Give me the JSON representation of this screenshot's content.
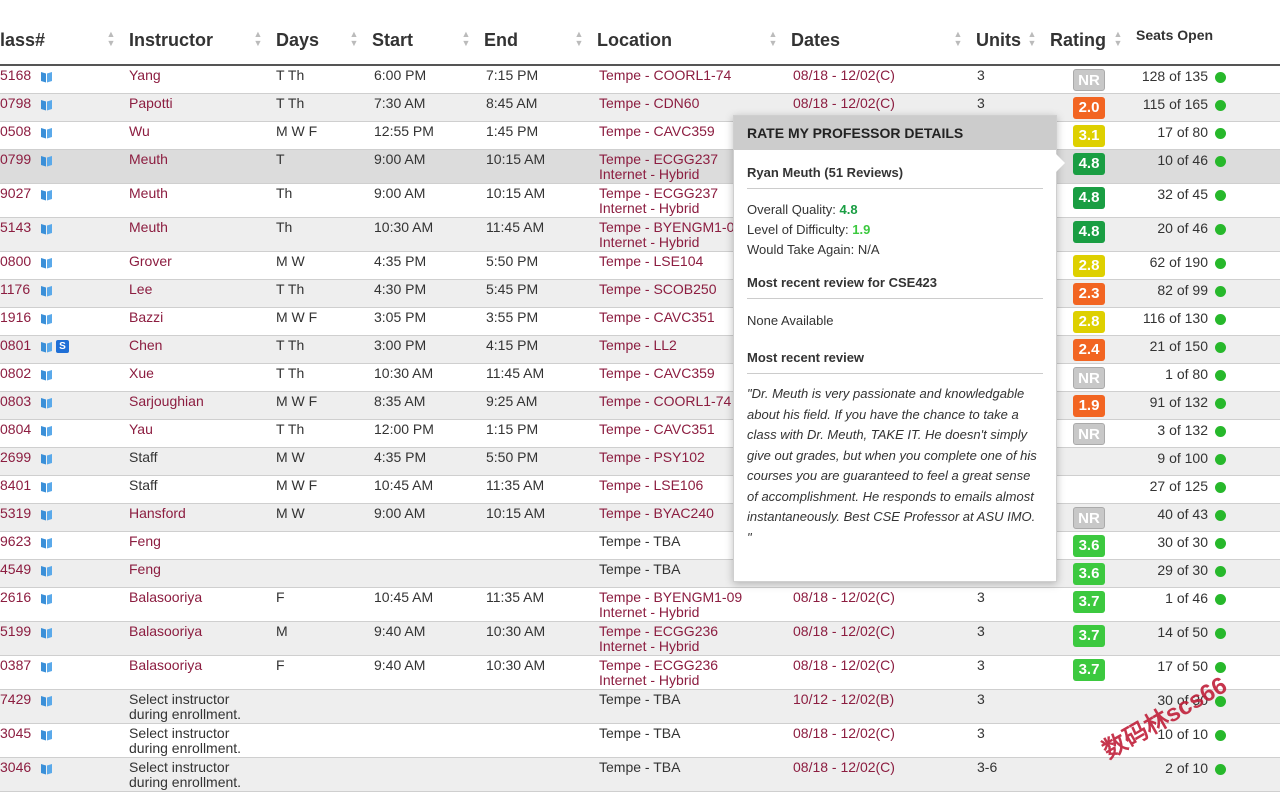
{
  "header": {
    "classnum": "lass#",
    "instructor": "Instructor",
    "days": "Days",
    "start": "Start",
    "end": "End",
    "location": "Location",
    "dates": "Dates",
    "units": "Units",
    "rating": "Rating",
    "seats": "Seats Open"
  },
  "colors": {
    "link": "#8c1d40",
    "rating_green": "#1a9e43",
    "rating_lightgreen": "#3cc93f",
    "rating_yellow": "#ded000",
    "rating_orange": "#f26522",
    "seats_dot": "#27b82b"
  },
  "rows": [
    {
      "classnum": "5168",
      "instructor": "Yang",
      "days": "T Th",
      "start": "6:00 PM",
      "end": "7:15 PM",
      "location": "Tempe - COORL1-74",
      "location2": "",
      "dates": "08/18 - 12/02(C)",
      "units": "3",
      "rating": "NR",
      "rating_color": "nr",
      "seats": "128 of 135",
      "instructor_link": true,
      "location_link": true,
      "s_icon": false
    },
    {
      "classnum": "0798",
      "instructor": "Papotti",
      "days": "T Th",
      "start": "7:30 AM",
      "end": "8:45 AM",
      "location": "Tempe - CDN60",
      "location2": "",
      "dates": "08/18 - 12/02(C)",
      "units": "3",
      "rating": "2.0",
      "rating_color": "orange",
      "seats": "115 of 165",
      "instructor_link": true,
      "location_link": true,
      "s_icon": false
    },
    {
      "classnum": "0508",
      "instructor": "Wu",
      "days": "M W F",
      "start": "12:55 PM",
      "end": "1:45 PM",
      "location": "Tempe - CAVC359",
      "location2": "",
      "dates": "",
      "units": "",
      "rating": "3.1",
      "rating_color": "yellow",
      "seats": "17 of 80",
      "instructor_link": true,
      "location_link": true,
      "s_icon": false
    },
    {
      "classnum": "0799",
      "instructor": "Meuth",
      "days": "T",
      "start": "9:00 AM",
      "end": "10:15 AM",
      "location": "Tempe - ECGG237",
      "location2": "Internet - Hybrid",
      "dates": "",
      "units": "",
      "rating": "4.8",
      "rating_color": "green",
      "seats": "10 of 46",
      "instructor_link": true,
      "location_link": true,
      "s_icon": false
    },
    {
      "classnum": "9027",
      "instructor": "Meuth",
      "days": "Th",
      "start": "9:00 AM",
      "end": "10:15 AM",
      "location": "Tempe - ECGG237",
      "location2": "Internet - Hybrid",
      "dates": "",
      "units": "",
      "rating": "4.8",
      "rating_color": "green",
      "seats": "32 of 45",
      "instructor_link": true,
      "location_link": true,
      "s_icon": false
    },
    {
      "classnum": "5143",
      "instructor": "Meuth",
      "days": "Th",
      "start": "10:30 AM",
      "end": "11:45 AM",
      "location": "Tempe - BYENGM1-0",
      "location2": "Internet - Hybrid",
      "dates": "",
      "units": "",
      "rating": "4.8",
      "rating_color": "green",
      "seats": "20 of 46",
      "instructor_link": true,
      "location_link": true,
      "s_icon": false
    },
    {
      "classnum": "0800",
      "instructor": "Grover",
      "days": "M W",
      "start": "4:35 PM",
      "end": "5:50 PM",
      "location": "Tempe - LSE104",
      "location2": "",
      "dates": "",
      "units": "",
      "rating": "2.8",
      "rating_color": "yellow",
      "seats": "62 of 190",
      "instructor_link": true,
      "location_link": true,
      "s_icon": false
    },
    {
      "classnum": "1176",
      "instructor": "Lee",
      "days": "T Th",
      "start": "4:30 PM",
      "end": "5:45 PM",
      "location": "Tempe - SCOB250",
      "location2": "",
      "dates": "",
      "units": "",
      "rating": "2.3",
      "rating_color": "orange",
      "seats": "82 of 99",
      "instructor_link": true,
      "location_link": true,
      "s_icon": false
    },
    {
      "classnum": "1916",
      "instructor": "Bazzi",
      "days": "M W F",
      "start": "3:05 PM",
      "end": "3:55 PM",
      "location": "Tempe - CAVC351",
      "location2": "",
      "dates": "",
      "units": "",
      "rating": "2.8",
      "rating_color": "yellow",
      "seats": "116 of 130",
      "instructor_link": true,
      "location_link": true,
      "s_icon": false
    },
    {
      "classnum": "0801",
      "instructor": "Chen",
      "days": "T Th",
      "start": "3:00 PM",
      "end": "4:15 PM",
      "location": "Tempe - LL2",
      "location2": "",
      "dates": "",
      "units": "",
      "rating": "2.4",
      "rating_color": "orange",
      "seats": "21 of 150",
      "instructor_link": true,
      "location_link": true,
      "s_icon": true
    },
    {
      "classnum": "0802",
      "instructor": "Xue",
      "days": "T Th",
      "start": "10:30 AM",
      "end": "11:45 AM",
      "location": "Tempe - CAVC359",
      "location2": "",
      "dates": "",
      "units": "",
      "rating": "NR",
      "rating_color": "nr",
      "seats": "1 of 80",
      "instructor_link": true,
      "location_link": true,
      "s_icon": false
    },
    {
      "classnum": "0803",
      "instructor": "Sarjoughian",
      "days": "M W F",
      "start": "8:35 AM",
      "end": "9:25 AM",
      "location": "Tempe - COORL1-74",
      "location2": "",
      "dates": "",
      "units": "",
      "rating": "1.9",
      "rating_color": "orange",
      "seats": "91 of 132",
      "instructor_link": true,
      "location_link": true,
      "s_icon": false
    },
    {
      "classnum": "0804",
      "instructor": "Yau",
      "days": "T Th",
      "start": "12:00 PM",
      "end": "1:15 PM",
      "location": "Tempe - CAVC351",
      "location2": "",
      "dates": "",
      "units": "",
      "rating": "NR",
      "rating_color": "nr",
      "seats": "3 of 132",
      "instructor_link": true,
      "location_link": true,
      "s_icon": false
    },
    {
      "classnum": "2699",
      "instructor": "Staff",
      "days": "M W",
      "start": "4:35 PM",
      "end": "5:50 PM",
      "location": "Tempe - PSY102",
      "location2": "",
      "dates": "",
      "units": "",
      "rating": "",
      "rating_color": "",
      "seats": "9 of 100",
      "instructor_link": false,
      "location_link": true,
      "s_icon": false
    },
    {
      "classnum": "8401",
      "instructor": "Staff",
      "days": "M W F",
      "start": "10:45 AM",
      "end": "11:35 AM",
      "location": "Tempe - LSE106",
      "location2": "",
      "dates": "",
      "units": "",
      "rating": "",
      "rating_color": "",
      "seats": "27 of 125",
      "instructor_link": false,
      "location_link": true,
      "s_icon": false
    },
    {
      "classnum": "5319",
      "instructor": "Hansford",
      "days": "M W",
      "start": "9:00 AM",
      "end": "10:15 AM",
      "location": "Tempe - BYAC240",
      "location2": "",
      "dates": "",
      "units": "",
      "rating": "NR",
      "rating_color": "nr",
      "seats": "40 of 43",
      "instructor_link": true,
      "location_link": true,
      "s_icon": false
    },
    {
      "classnum": "9623",
      "instructor": "Feng",
      "days": "",
      "start": "",
      "end": "",
      "location": "Tempe - TBA",
      "location2": "",
      "dates": "",
      "units": "",
      "rating": "3.6",
      "rating_color": "lgreen",
      "seats": "30 of 30",
      "instructor_link": true,
      "location_link": false,
      "s_icon": false
    },
    {
      "classnum": "4549",
      "instructor": "Feng",
      "days": "",
      "start": "",
      "end": "",
      "location": "Tempe - TBA",
      "location2": "",
      "dates": "",
      "units": "",
      "rating": "3.6",
      "rating_color": "lgreen",
      "seats": "29 of 30",
      "instructor_link": true,
      "location_link": false,
      "s_icon": false
    },
    {
      "classnum": "2616",
      "instructor": "Balasooriya",
      "days": "F",
      "start": "10:45 AM",
      "end": "11:35 AM",
      "location": "Tempe - BYENGM1-09",
      "location2": "Internet - Hybrid",
      "dates": "08/18 - 12/02(C)",
      "units": "3",
      "rating": "3.7",
      "rating_color": "lgreen",
      "seats": "1 of 46",
      "instructor_link": true,
      "location_link": true,
      "s_icon": false
    },
    {
      "classnum": "5199",
      "instructor": "Balasooriya",
      "days": "M",
      "start": "9:40 AM",
      "end": "10:30 AM",
      "location": "Tempe - ECGG236",
      "location2": "Internet - Hybrid",
      "dates": "08/18 - 12/02(C)",
      "units": "3",
      "rating": "3.7",
      "rating_color": "lgreen",
      "seats": "14 of 50",
      "instructor_link": true,
      "location_link": true,
      "s_icon": false
    },
    {
      "classnum": "0387",
      "instructor": "Balasooriya",
      "days": "F",
      "start": "9:40 AM",
      "end": "10:30 AM",
      "location": "Tempe - ECGG236",
      "location2": "Internet - Hybrid",
      "dates": "08/18 - 12/02(C)",
      "units": "3",
      "rating": "3.7",
      "rating_color": "lgreen",
      "seats": "17 of 50",
      "instructor_link": true,
      "location_link": true,
      "s_icon": false
    },
    {
      "classnum": "7429",
      "instructor": "Select instructor",
      "instructor2": "during enrollment.",
      "days": "",
      "start": "",
      "end": "",
      "location": "Tempe - TBA",
      "location2": "",
      "dates": "10/12 - 12/02(B)",
      "units": "3",
      "rating": "",
      "rating_color": "",
      "seats": "30 of 30",
      "instructor_link": false,
      "location_link": false,
      "s_icon": false
    },
    {
      "classnum": "3045",
      "instructor": "Select instructor",
      "instructor2": "during enrollment.",
      "days": "",
      "start": "",
      "end": "",
      "location": "Tempe - TBA",
      "location2": "",
      "dates": "08/18 - 12/02(C)",
      "units": "3",
      "rating": "",
      "rating_color": "",
      "seats": "10 of 10",
      "instructor_link": false,
      "location_link": false,
      "s_icon": false
    },
    {
      "classnum": "3046",
      "instructor": "Select instructor",
      "instructor2": "during enrollment.",
      "days": "",
      "start": "",
      "end": "",
      "location": "Tempe - TBA",
      "location2": "",
      "dates": "08/18 - 12/02(C)",
      "units": "3-6",
      "rating": "",
      "rating_color": "",
      "seats": "2 of 10",
      "instructor_link": false,
      "location_link": false,
      "s_icon": false
    }
  ],
  "popup": {
    "title": "RATE MY PROFESSOR DETAILS",
    "name": "Ryan Meuth (51 Reviews)",
    "quality_label": "Overall Quality:",
    "quality_value": "4.8",
    "difficulty_label": "Level of Difficulty:",
    "difficulty_value": "1.9",
    "take_again": "Would Take Again: N/A",
    "recent_course_heading": "Most recent review for CSE423",
    "recent_course_text": "None Available",
    "recent_heading": "Most recent review",
    "review": "\"Dr. Meuth is very passionate and knowledgable about his field. If you have the chance to take a class with Dr. Meuth, TAKE IT. He doesn't simply give out grades, but when you complete one of his courses you are guaranteed to feel a great sense of accomplishment. He responds to emails almost instantaneously. Best CSE Professor at ASU IMO. \""
  },
  "watermark": "数码林scs66"
}
